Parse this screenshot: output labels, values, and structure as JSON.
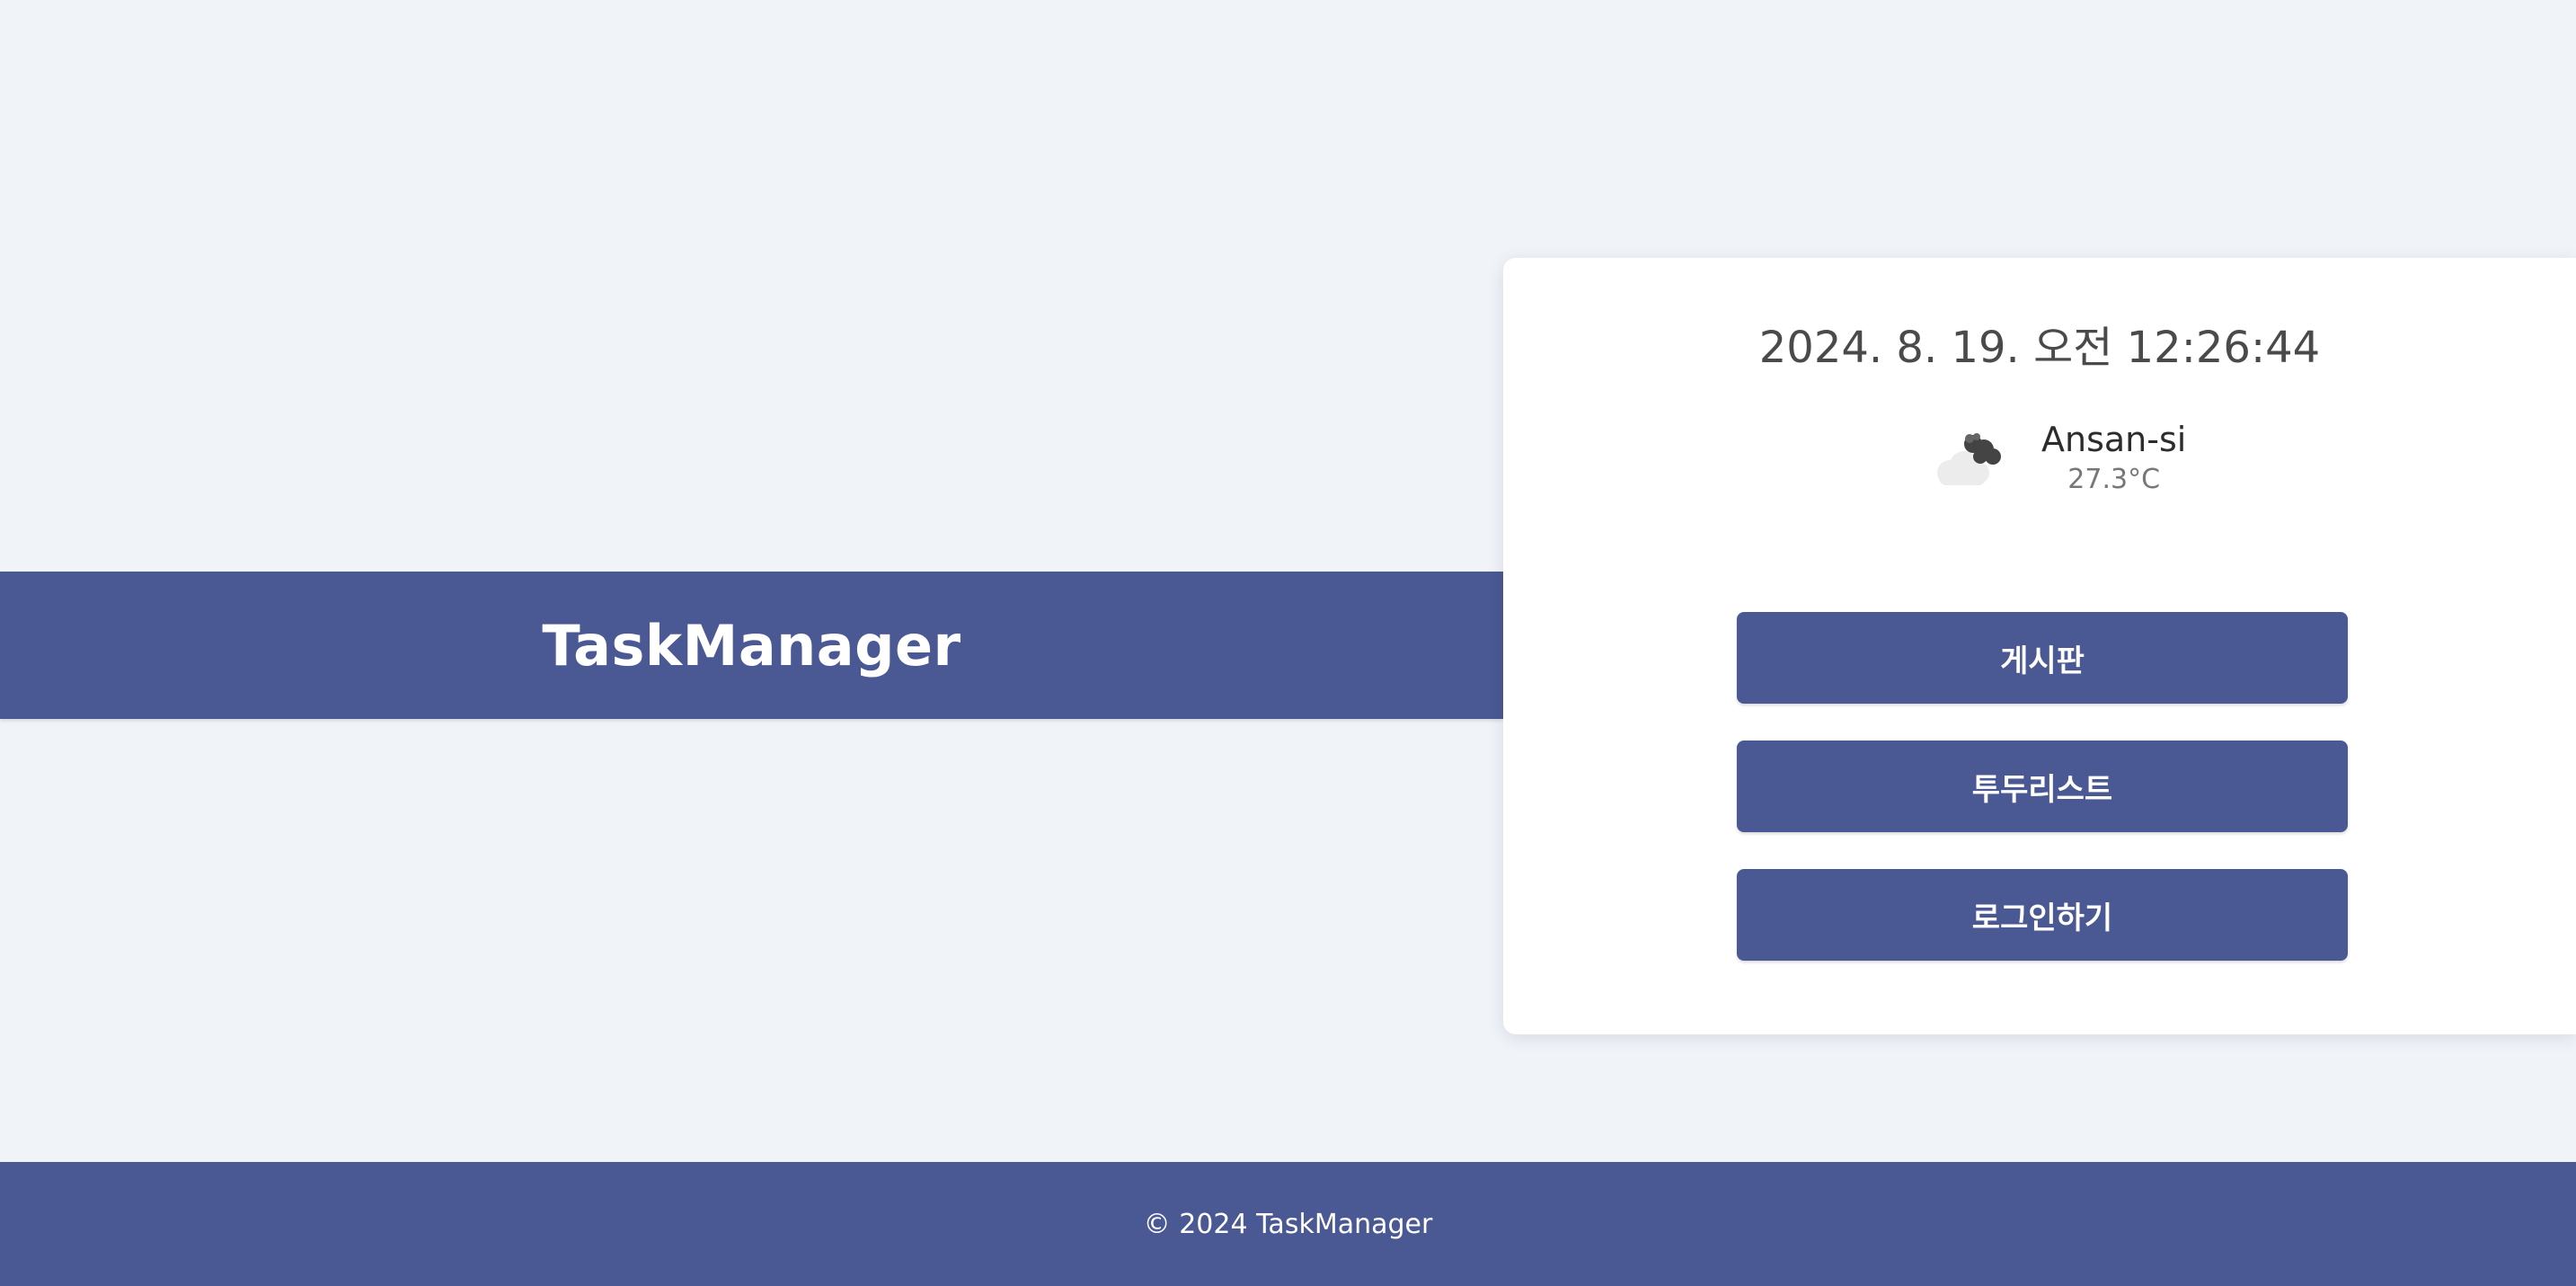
{
  "hero": {
    "title": "TaskManager"
  },
  "card": {
    "datetime": "2024. 8. 19. 오전 12:26:44",
    "weather": {
      "icon": "cloudy-night-icon",
      "city": "Ansan-si",
      "temperature": "27.3°C"
    },
    "buttons": {
      "board": "게시판",
      "todolist": "투두리스트",
      "login": "로그인하기"
    }
  },
  "footer": {
    "copyright": "© 2024 TaskManager"
  },
  "colors": {
    "brand": "#4a5893",
    "background": "#f0f3f8",
    "card": "#ffffff"
  }
}
